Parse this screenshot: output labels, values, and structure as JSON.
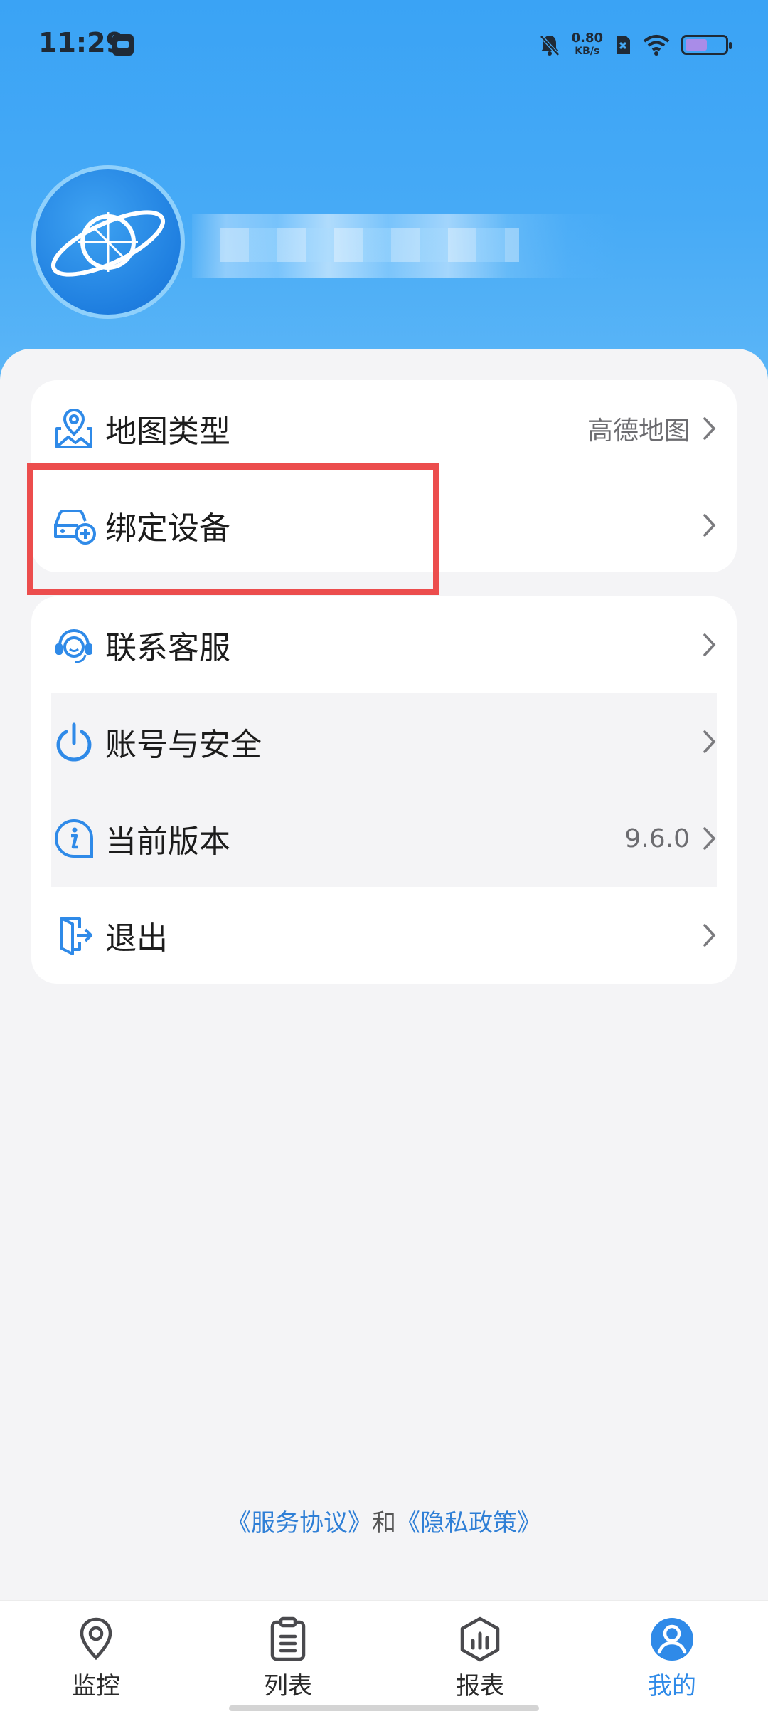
{
  "status_bar": {
    "time": "11:29",
    "net_speed_value": "0.80",
    "net_speed_unit": "KB/s",
    "icons": [
      "mute-icon",
      "sim-icon",
      "wifi-icon",
      "battery-icon"
    ]
  },
  "profile": {
    "avatar_icon": "planet-logo-icon"
  },
  "menu_group_1": [
    {
      "label": "地图类型",
      "value": "高德地图",
      "icon": "map-pin-icon"
    },
    {
      "label": "绑定设备",
      "value": "",
      "icon": "car-add-icon"
    }
  ],
  "menu_group_2": [
    {
      "label": "联系客服",
      "value": "",
      "icon": "headset-icon"
    },
    {
      "label": "账号与安全",
      "value": "",
      "icon": "power-icon"
    },
    {
      "label": "当前版本",
      "value": "9.6.0",
      "icon": "info-icon"
    },
    {
      "label": "退出",
      "value": "",
      "icon": "exit-icon"
    }
  ],
  "footer": {
    "service_agreement": "《服务协议》",
    "conjunction": "和",
    "privacy_policy": "《隐私政策》"
  },
  "tabbar": {
    "tabs": [
      {
        "label": "监控",
        "icon": "location-icon",
        "active": false
      },
      {
        "label": "列表",
        "icon": "clipboard-icon",
        "active": false
      },
      {
        "label": "报表",
        "icon": "report-icon",
        "active": false
      },
      {
        "label": "我的",
        "icon": "user-icon",
        "active": true
      }
    ]
  },
  "colors": {
    "accent": "#2f8ae8",
    "header_blue": "#3aa3f5",
    "highlight_red": "#ec4d4d"
  }
}
